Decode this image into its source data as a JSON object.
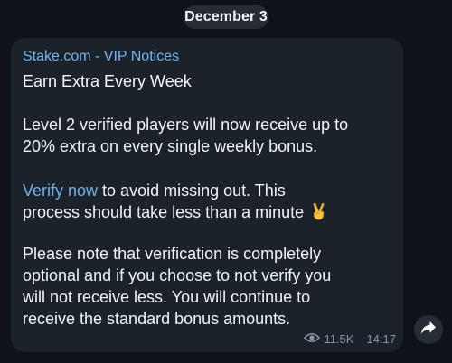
{
  "date_separator": "December 3",
  "message": {
    "channel_name": "Stake.com - VIP Notices",
    "title": "Earn Extra Every Week",
    "paragraph_1_line_1": "Level 2 verified players will now receive up to",
    "paragraph_1_line_2": "20% extra on every single weekly bonus.",
    "verify_link": "Verify now",
    "paragraph_2_line_1_rest": " to avoid missing out. This",
    "paragraph_2_line_2": "process should take less than a minute ",
    "paragraph_3_line_1": "Please note that verification is completely",
    "paragraph_3_line_2": "optional and if you choose to not verify you",
    "paragraph_3_line_3": "will not receive less. You will continue to",
    "paragraph_3_line_4": "receive the standard bonus amounts.",
    "views": "11.5K",
    "time": "14:17",
    "emoji_icon": "victory-hand-icon"
  },
  "icons": {
    "views": "eye-icon",
    "share": "share-arrow-icon"
  },
  "colors": {
    "background": "#0f1218",
    "bubble": "#1c222a",
    "link": "#70b2ee",
    "channel_name": "#77b6ef",
    "date_pill": "#262b35",
    "meta_text": "#8a96a3"
  }
}
